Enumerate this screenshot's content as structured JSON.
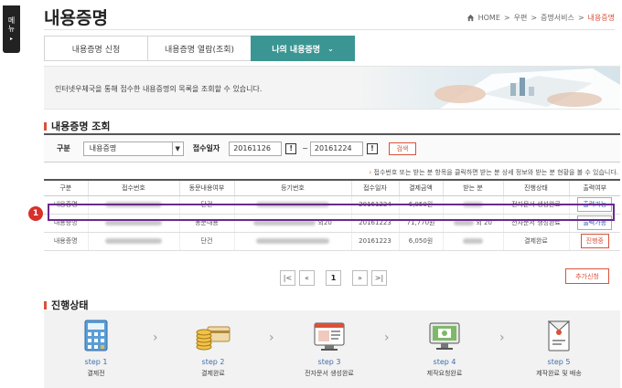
{
  "side_tab": {
    "label_chars": [
      "메",
      "뉴"
    ],
    "arrow": "▸"
  },
  "page": {
    "title": "내용증명"
  },
  "breadcrumb": {
    "items": [
      "HOME",
      "우편",
      "증명서비스"
    ],
    "separator": ">",
    "current": "내용증명"
  },
  "tabs": [
    {
      "label": "내용증명 신청",
      "active": false
    },
    {
      "label": "내용증명 열람(조회)",
      "active": false
    },
    {
      "label": "나의 내용증명",
      "active": true,
      "chevron": "⌄"
    }
  ],
  "banner": {
    "text": "인터넷우체국을 통해 접수한 내용증명의 목록을 조회할 수 있습니다."
  },
  "search_section": {
    "title": "내용증명 조회",
    "type_label": "구분",
    "type_value": "내용증명",
    "date_label": "접수일자",
    "date_from": "20161126",
    "date_to": "20161224",
    "tilde": "~",
    "search_button": "검색"
  },
  "note": {
    "arrow": "›",
    "text": "접수번호 또는 받는 분 항목을 클릭하면 받는 분 상세 정보와 받는 분 현황을 볼 수 있습니다."
  },
  "table": {
    "headers": [
      "구분",
      "접수번호",
      "동문내용여부",
      "등기번호",
      "접수일자",
      "결제금액",
      "받는 분",
      "진행상태",
      "출력여부"
    ],
    "rows": [
      {
        "type": "내용증명",
        "multi": "단건",
        "regno_suffix": "",
        "date": "20161224",
        "amount": "6,050원",
        "recv_suffix": "",
        "status": "전자문서 생성완료",
        "action": "출력가능",
        "action_style": "blue"
      },
      {
        "type": "내용증명",
        "multi": "동문내용",
        "regno_suffix": "외20",
        "date": "20161223",
        "amount": "71,770원",
        "recv_suffix": "외 20",
        "status": "전자문서 생성완료",
        "action": "출력가능",
        "action_style": "blue"
      },
      {
        "type": "내용증명",
        "multi": "단건",
        "regno_suffix": "",
        "date": "20161223",
        "amount": "6,050원",
        "recv_suffix": "",
        "status": "결제완료",
        "action": "진행중",
        "action_style": "red"
      }
    ]
  },
  "annotation_badge": "1",
  "pagination": {
    "first": "|<",
    "prev": "«",
    "current": "1",
    "next": "»",
    "last": ">|"
  },
  "add_button": "추가신청",
  "progress_section": {
    "title": "진행상태",
    "steps": [
      {
        "step": "step 1",
        "desc": "결제전",
        "icon": "calculator-icon"
      },
      {
        "step": "step 2",
        "desc": "결제완료",
        "icon": "coins-card-icon"
      },
      {
        "step": "step 3",
        "desc": "전자문서 생성완료",
        "icon": "document-screen-icon"
      },
      {
        "step": "step 4",
        "desc": "제작요청완료",
        "icon": "monitor-icon"
      },
      {
        "step": "step 5",
        "desc": "제작완료 및 배송",
        "icon": "envelope-icon"
      }
    ]
  },
  "colors": {
    "accent_teal": "#3b9693",
    "accent_red": "#d9513b",
    "highlight_purple": "#6b2a8c",
    "link_blue": "#1a5cb0"
  }
}
